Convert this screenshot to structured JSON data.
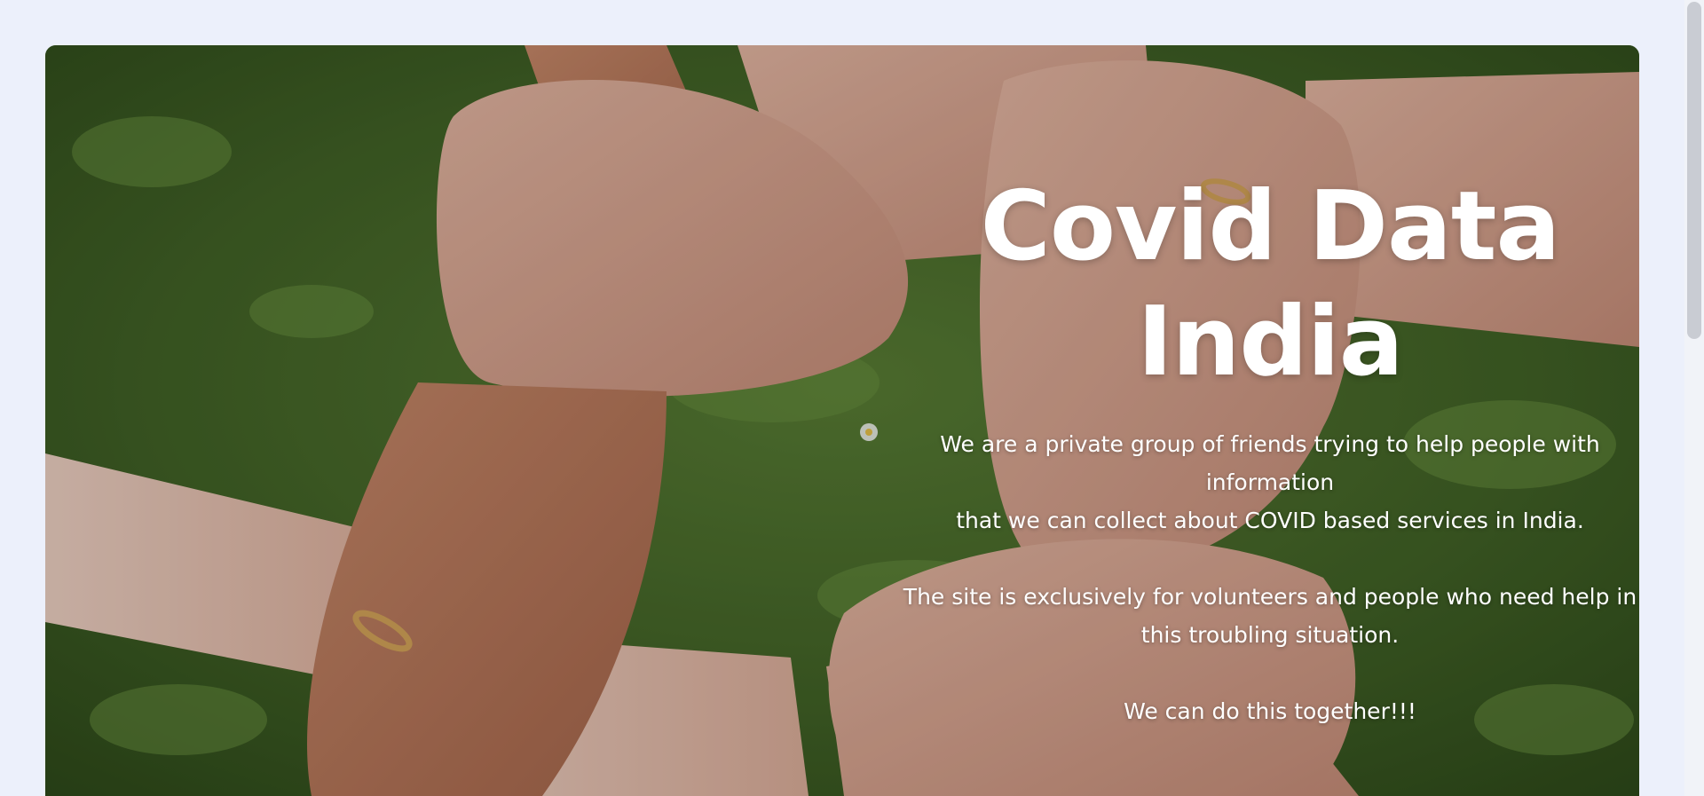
{
  "hero": {
    "title_line1": "Covid Data",
    "title_line2": "India",
    "paragraph1_line1": "We are a private group of friends trying to help people with",
    "paragraph1_line2": "information",
    "paragraph1_line3": "that we can collect about COVID based services in India.",
    "paragraph2_line1": "The site is exclusively for volunteers and people who need help in",
    "paragraph2_line2": "this troubling situation.",
    "paragraph3": "We can do this together!!!",
    "background_image": "hands-linked-circle-on-grass",
    "text_color": "#ffffff"
  },
  "page": {
    "background_color": "#ecf0fb"
  }
}
